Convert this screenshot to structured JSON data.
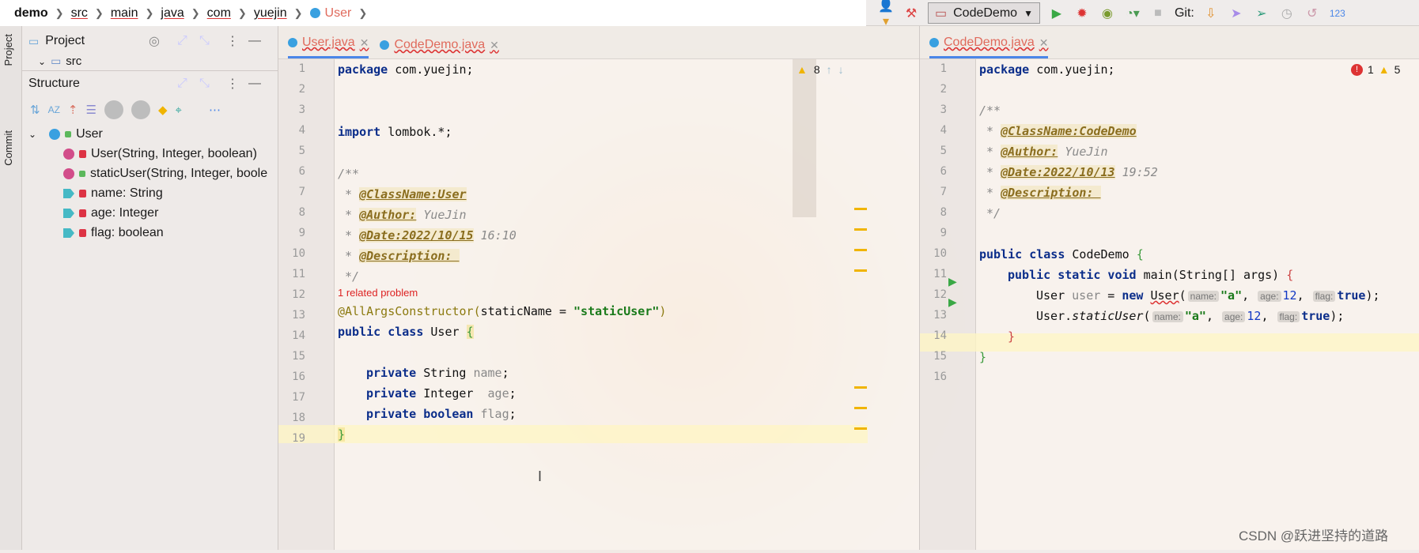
{
  "breadcrumbs": [
    "demo",
    "src",
    "main",
    "java",
    "com",
    "yuejin",
    "User"
  ],
  "toolbar": {
    "run_config": "CodeDemo",
    "git_label": "Git:"
  },
  "left_strip": {
    "project_tab": "Project",
    "commit_tab": "Commit"
  },
  "project_panel": {
    "title": "Project",
    "src_label": "src"
  },
  "structure_panel": {
    "title": "Structure",
    "root": "User",
    "items": [
      "User(String, Integer, boolean)",
      "staticUser(String, Integer, boole",
      "name: String",
      "age: Integer",
      "flag: boolean"
    ]
  },
  "editor_left": {
    "tabs": [
      "User.java",
      "CodeDemo.java"
    ],
    "warning_count": "8",
    "problem_hint": "1 related problem",
    "line_numbers": [
      "1",
      "2",
      "3",
      "4",
      "5",
      "6",
      "7",
      "8",
      "9",
      "10",
      "11",
      "12",
      "13",
      "14",
      "15",
      "16",
      "17",
      "18",
      "19"
    ],
    "code": {
      "l1_kw": "package",
      "l1_rest": " com.yuejin;",
      "l4_kw": "import",
      "l4_rest": " lombok.*;",
      "l6": "/**",
      "l7_tag": "@ClassName:User",
      "l8_tag": "@Author:",
      "l8_rest": " YueJin",
      "l9_tag": "@Date:2022/10/15",
      "l9_rest": " 16:10",
      "l10_tag": "@Description: ",
      "l11": " */",
      "l12_anno": "@AllArgsConstructor(",
      "l12_mid": "staticName = ",
      "l12_str": "\"staticUser\"",
      "l12_end": ")",
      "l13_kw": "public class",
      "l13_rest": " User ",
      "l13_brace": "{",
      "l15_kw": "private",
      "l15_type": " String ",
      "l15_fld": "name",
      "l15_end": ";",
      "l16_kw": "private",
      "l16_type": " Integer  ",
      "l16_fld": "age",
      "l16_end": ";",
      "l17_kw": "private boolean",
      "l17_fld": " flag",
      "l17_end": ";",
      "l18": "}"
    }
  },
  "editor_right": {
    "tabs": [
      "CodeDemo.java"
    ],
    "error_count": "1",
    "warning_count": "5",
    "line_numbers": [
      "1",
      "2",
      "3",
      "4",
      "5",
      "6",
      "7",
      "8",
      "9",
      "10",
      "11",
      "12",
      "13",
      "14",
      "15",
      "16"
    ],
    "code": {
      "l1_kw": "package",
      "l1_rest": " com.yuejin;",
      "l3": "/**",
      "l4_tag": "@ClassName:CodeDemo",
      "l5_tag": "@Author:",
      "l5_rest": " YueJin",
      "l6_tag": "@Date:2022/10/13",
      "l6_rest": " 19:52",
      "l7_tag": "@Description: ",
      "l8": " */",
      "l10_kw": "public class",
      "l10_rest": " CodeDemo ",
      "l10_brace": "{",
      "l11_kw": "public static void",
      "l11_rest": " main(String[] args) ",
      "l11_brace": "{",
      "l12_a": "User ",
      "l12_var": "user",
      "l12_b": " = ",
      "l12_kw": "new",
      "l12_c": " ",
      "l12_cls": "User",
      "l12_d": "(",
      "l13_a": "User.",
      "l13_m": "staticUser",
      "l13_d": "(",
      "hint_name": "name:",
      "hint_age": "age:",
      "hint_flag": "flag:",
      "arg_str": "\"a\"",
      "comma": ", ",
      "arg_num": "12",
      "arg_bool": "true",
      "end": ");",
      "l14": "}",
      "l15": "}"
    }
  },
  "watermark": "CSDN @跃进坚持的道路"
}
